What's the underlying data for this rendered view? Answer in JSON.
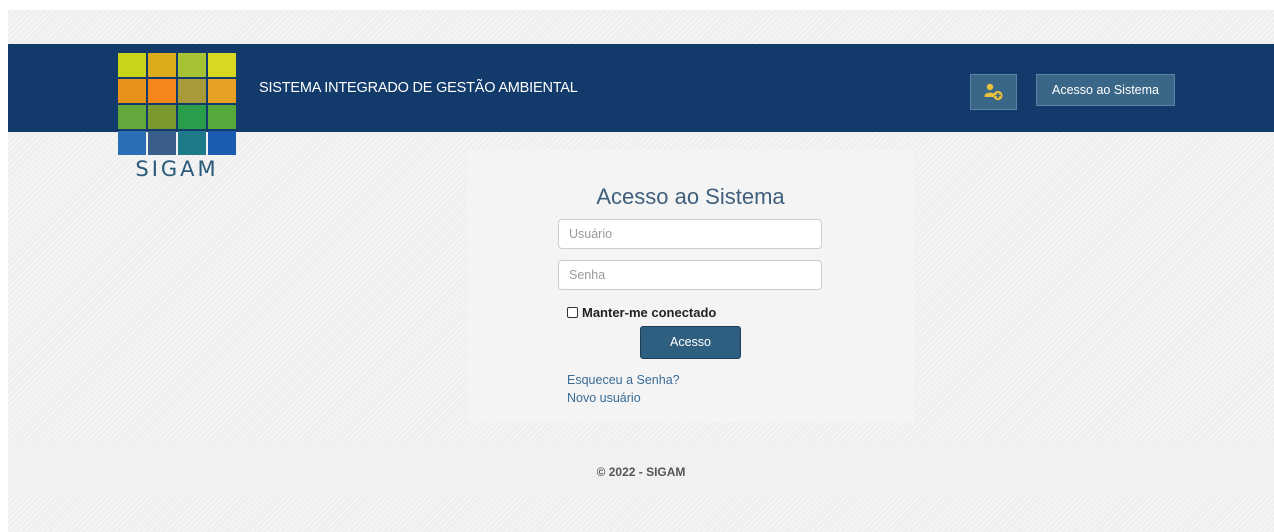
{
  "header": {
    "logo_text": "SIGAM",
    "title": "SISTEMA INTEGRADO DE GESTÃO AMBIENTAL",
    "register_icon": "user-add-icon",
    "access_button": "Acesso ao Sistema"
  },
  "login": {
    "title": "Acesso ao Sistema",
    "username_placeholder": "Usuário",
    "password_placeholder": "Senha",
    "remember_label": "Manter-me conectado",
    "remember_checked": false,
    "submit_label": "Acesso",
    "forgot_link": "Esqueceu a Senha?",
    "new_user_link": "Novo usuário"
  },
  "footer": {
    "copyright": "© 2022 - SIGAM"
  },
  "colors": {
    "header_bg": "#123a6b",
    "button_bg": "#3a6688",
    "submit_bg": "#2f5f80",
    "link": "#3a6c97",
    "icon_accent": "#e6c23a"
  }
}
